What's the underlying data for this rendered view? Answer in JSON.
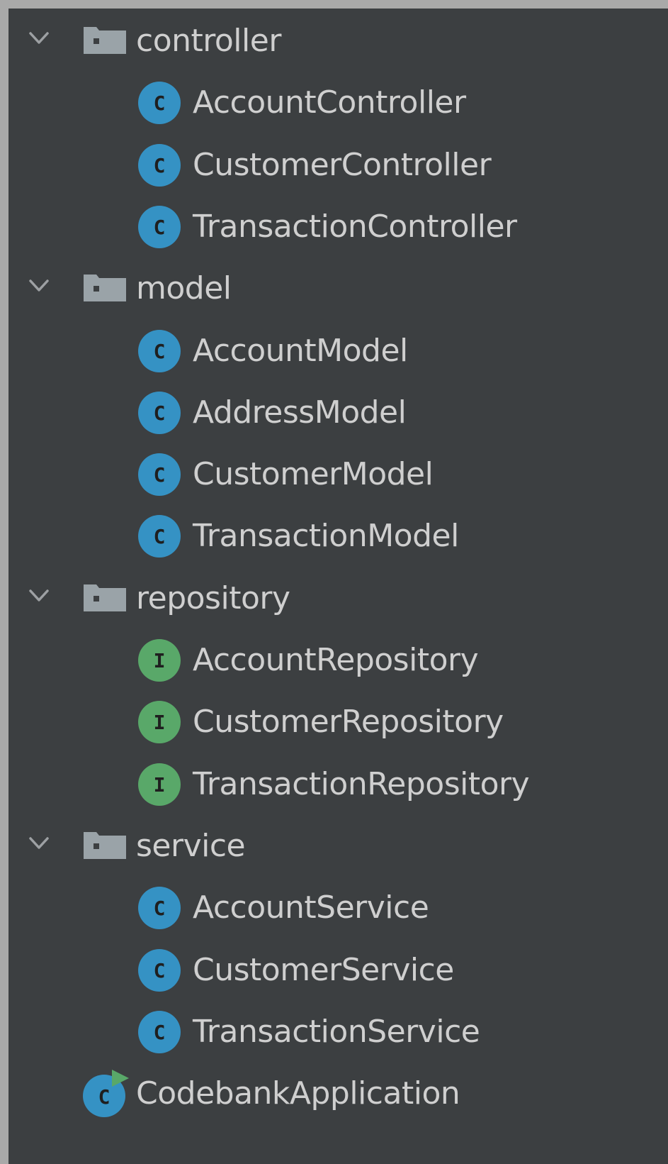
{
  "tree": {
    "packages": [
      {
        "name": "controller",
        "expanded": true,
        "items": [
          {
            "name": "AccountController",
            "kind": "class"
          },
          {
            "name": "CustomerController",
            "kind": "class"
          },
          {
            "name": "TransactionController",
            "kind": "class"
          }
        ]
      },
      {
        "name": "model",
        "expanded": true,
        "items": [
          {
            "name": "AccountModel",
            "kind": "class"
          },
          {
            "name": "AddressModel",
            "kind": "class"
          },
          {
            "name": "CustomerModel",
            "kind": "class"
          },
          {
            "name": "TransactionModel",
            "kind": "class"
          }
        ]
      },
      {
        "name": "repository",
        "expanded": true,
        "items": [
          {
            "name": "AccountRepository",
            "kind": "interface"
          },
          {
            "name": "CustomerRepository",
            "kind": "interface"
          },
          {
            "name": "TransactionRepository",
            "kind": "interface"
          }
        ]
      },
      {
        "name": "service",
        "expanded": true,
        "items": [
          {
            "name": "AccountService",
            "kind": "class"
          },
          {
            "name": "CustomerService",
            "kind": "class"
          },
          {
            "name": "TransactionService",
            "kind": "class"
          }
        ]
      }
    ],
    "application": {
      "name": "CodebankApplication",
      "kind": "spring-boot-application"
    }
  },
  "icons": {
    "chevron": "chevron-down-icon",
    "package": "package-folder-icon",
    "class": "class-icon",
    "interface": "interface-icon",
    "application": "spring-boot-application-icon",
    "class_badge_letter": "C",
    "interface_badge_letter": "I"
  },
  "colors": {
    "background": "#3c3f41",
    "frame": "#a9a9a9",
    "text": "#cfcfcf",
    "folder": "#9aa3a8",
    "class_badge": "#3592c4",
    "interface_badge": "#59a869",
    "run_marker": "#59a869",
    "chevron": "#9da0a3"
  }
}
